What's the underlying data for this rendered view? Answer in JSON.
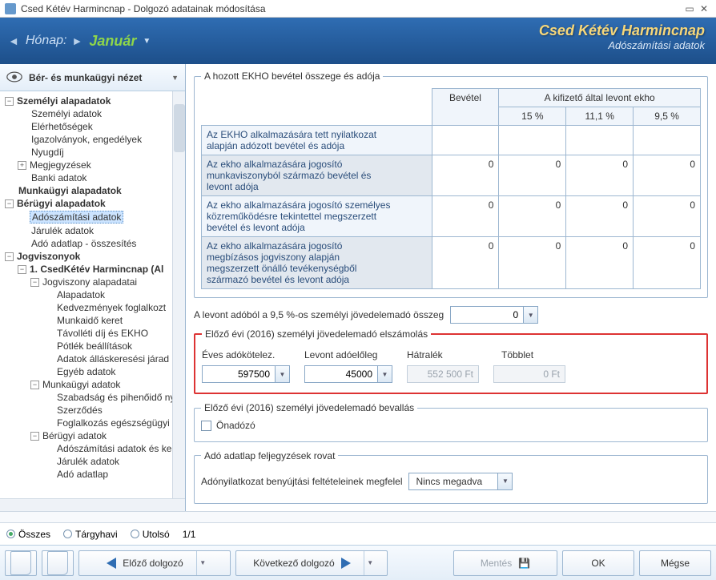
{
  "title": "Csed Kétév Harmincnap - Dolgozó adatainak módosítása",
  "ribbon": {
    "honap_label": "Hónap:",
    "month": "Január",
    "brand_line1": "Csed Kétév Harmincnap",
    "brand_line2": "Adószámítási adatok"
  },
  "view_selector": "Bér- és munkaügyi nézet",
  "tree": [
    {
      "d": 0,
      "pm": "-",
      "label": "Személyi alapadatok",
      "bold": true
    },
    {
      "d": 1,
      "label": "Személyi adatok"
    },
    {
      "d": 1,
      "label": "Elérhetőségek"
    },
    {
      "d": 1,
      "label": "Igazolványok, engedélyek"
    },
    {
      "d": 1,
      "label": "Nyugdíj"
    },
    {
      "d": 1,
      "pm": "+",
      "label": "Megjegyzések"
    },
    {
      "d": 1,
      "label": "Banki adatok"
    },
    {
      "d": 0,
      "label": "Munkaügyi alapadatok",
      "bold": true
    },
    {
      "d": 0,
      "pm": "-",
      "label": "Bérügyi alapadatok",
      "bold": true
    },
    {
      "d": 1,
      "label": "Adószámítási adatok",
      "selected": true
    },
    {
      "d": 1,
      "label": "Járulék adatok"
    },
    {
      "d": 1,
      "label": "Adó adatlap - összesítés"
    },
    {
      "d": 0,
      "pm": "-",
      "label": "Jogviszonyok",
      "bold": true
    },
    {
      "d": 1,
      "pm": "-",
      "label": "1. CsedKétév Harmincnap (Al",
      "bold": true
    },
    {
      "d": 2,
      "pm": "-",
      "label": "Jogviszony alapadatai"
    },
    {
      "d": 3,
      "label": "Alapadatok"
    },
    {
      "d": 3,
      "label": "Kedvezmények foglalkozt"
    },
    {
      "d": 3,
      "label": "Munkaidő keret"
    },
    {
      "d": 3,
      "label": "Távolléti díj és EKHO"
    },
    {
      "d": 3,
      "label": "Pótlék beállítások"
    },
    {
      "d": 3,
      "label": "Adatok álláskeresési járad"
    },
    {
      "d": 3,
      "label": "Egyéb adatok"
    },
    {
      "d": 2,
      "pm": "-",
      "label": "Munkaügyi adatok"
    },
    {
      "d": 3,
      "label": "Szabadság és pihenőidő ny"
    },
    {
      "d": 3,
      "label": "Szerződés"
    },
    {
      "d": 3,
      "label": "Foglalkozás egészségügyi :"
    },
    {
      "d": 2,
      "pm": "-",
      "label": "Bérügyi adatok"
    },
    {
      "d": 3,
      "label": "Adószámítási adatok és ke"
    },
    {
      "d": 3,
      "label": "Járulék adatok"
    },
    {
      "d": 3,
      "label": "Adó adatlap"
    }
  ],
  "content": {
    "ekho_title": "A hozott EKHO bevétel összege és adója",
    "ekho_group_header": "A kifizető által levont ekho",
    "ekho_cols": [
      "Bevétel",
      "15 %",
      "11,1 %",
      "9,5 %"
    ],
    "ekho_rows": [
      {
        "label": "Az EKHO alkalmazására tett nyilatkozat alapján adózott bevétel és adója",
        "vals": [
          "",
          "",
          "",
          ""
        ],
        "shaded": false
      },
      {
        "label": "Az ekho alkalmazására jogosító munkaviszonyból származó bevétel és levont adója",
        "vals": [
          "0",
          "0",
          "0",
          "0"
        ],
        "shaded": true
      },
      {
        "label": "Az ekho alkalmazására jogosító személyes közreműködésre tekintettel megszerzett bevétel és levont adója",
        "vals": [
          "0",
          "0",
          "0",
          "0"
        ],
        "shaded": false
      },
      {
        "label": "Az ekho alkalmazására jogosító megbízásos jogviszony alapján megszerzett önálló tevékenységből származó bevétel és levont adója",
        "vals": [
          "0",
          "0",
          "0",
          "0"
        ],
        "shaded": true
      }
    ],
    "levont_label": "A levont adóból a 9,5 %-os személyi jövedelemadó összeg",
    "levont_value": "0",
    "prev_title": "Előző évi (2016) személyi jövedelemadó elszámolás",
    "col_eves": "Éves adókötelez.",
    "col_levont": "Levont adóelőleg",
    "col_hatralek": "Hátralék",
    "col_tobblet": "Többlet",
    "val_eves": "597500",
    "val_levont": "45000",
    "val_hatralek": "552 500 Ft",
    "val_tobblet": "0 Ft",
    "bevall_title": "Előző évi (2016) személyi jövedelemadó bevallás",
    "onadozo": "Önadózó",
    "adatlap_title": "Adó adatlap feljegyzések rovat",
    "nyilatkozat_label": "Adónyilatkozat benyújtási feltételeinek megfelel",
    "nyilatkozat_value": "Nincs megadva"
  },
  "footer": {
    "osszes": "Összes",
    "targyhavi": "Tárgyhavi",
    "utolso": "Utolsó",
    "pager": "1/1"
  },
  "nav": {
    "prev": "Előző dolgozó",
    "next": "Következő dolgozó",
    "save": "Mentés",
    "ok": "OK",
    "cancel": "Mégse"
  }
}
